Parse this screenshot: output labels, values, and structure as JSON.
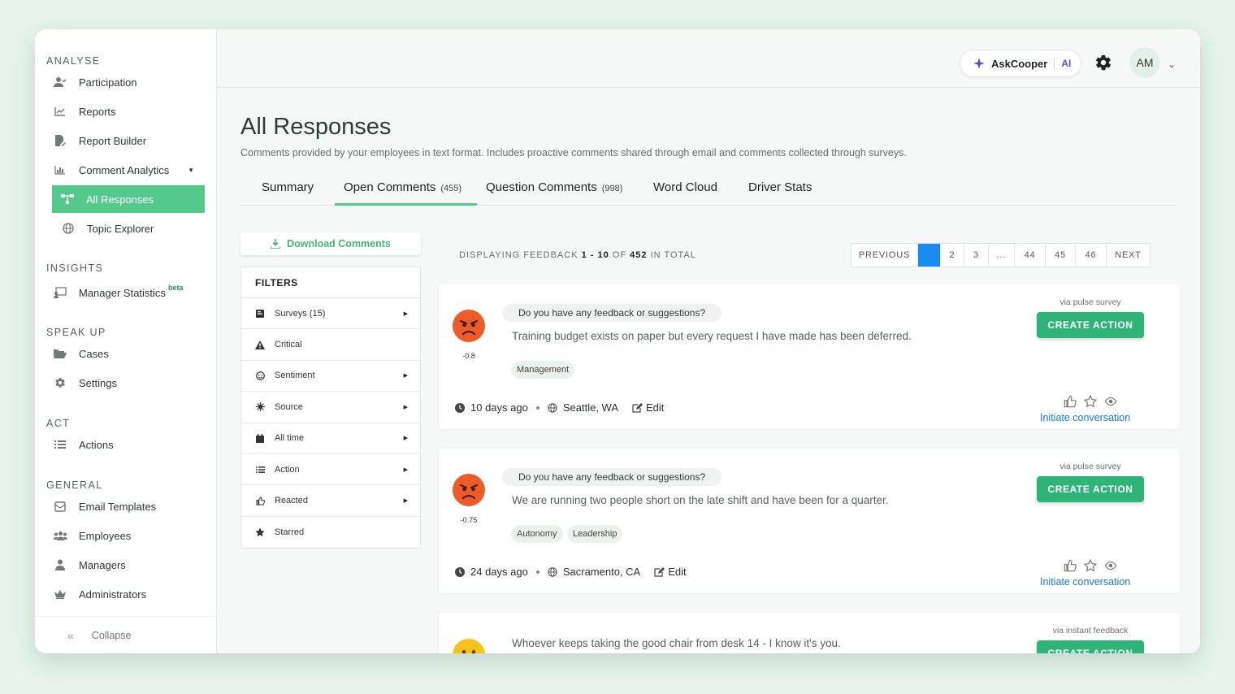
{
  "sidebar": {
    "sections": [
      {
        "title": "ANALYSE",
        "items": [
          {
            "label": "Participation",
            "icon": "user-check-icon"
          },
          {
            "label": "Reports",
            "icon": "line-chart-icon"
          },
          {
            "label": "Report Builder",
            "icon": "file-edit-icon"
          },
          {
            "label": "Comment Analytics",
            "icon": "bar-chart-icon",
            "has_caret": true
          },
          {
            "label": "All Responses",
            "icon": "network-icon",
            "active": true
          },
          {
            "label": "Topic Explorer",
            "icon": "globe-icon"
          }
        ]
      },
      {
        "title": "INSIGHTS",
        "items": [
          {
            "label": "Manager Statistics",
            "badge": "beta",
            "icon": "presentation-icon"
          }
        ]
      },
      {
        "title": "SPEAK UP",
        "items": [
          {
            "label": "Cases",
            "icon": "folder-open-icon"
          },
          {
            "label": "Settings",
            "icon": "gear-icon"
          }
        ]
      },
      {
        "title": "ACT",
        "items": [
          {
            "label": "Actions",
            "icon": "list-icon"
          }
        ]
      },
      {
        "title": "GENERAL",
        "items": [
          {
            "label": "Email Templates",
            "icon": "envelope-icon"
          },
          {
            "label": "Employees",
            "icon": "users-icon"
          },
          {
            "label": "Managers",
            "icon": "user-tie-icon"
          },
          {
            "label": "Administrators",
            "icon": "crown-icon"
          }
        ]
      }
    ],
    "collapse_label": "Collapse"
  },
  "topbar": {
    "ask_label": "AskCooper",
    "ai_label": "AI",
    "avatar_initials": "AM"
  },
  "page": {
    "title": "All Responses",
    "subtitle": "Comments provided by your employees in text format. Includes proactive comments shared through email and comments collected through surveys."
  },
  "tabs": [
    {
      "label": "Summary",
      "count": ""
    },
    {
      "label": "Open Comments",
      "count": "(455)",
      "active": true
    },
    {
      "label": "Question Comments",
      "count": "(998)"
    },
    {
      "label": "Word Cloud",
      "count": ""
    },
    {
      "label": "Driver Stats",
      "count": ""
    }
  ],
  "download_label": "Download Comments",
  "filters": {
    "header": "FILTERS",
    "items": [
      {
        "label": "Surveys (15)",
        "icon": "survey-icon",
        "caret": true
      },
      {
        "label": "Critical",
        "icon": "warning-icon",
        "caret": false
      },
      {
        "label": "Sentiment",
        "icon": "smile-icon",
        "caret": true
      },
      {
        "label": "Source",
        "icon": "source-icon",
        "caret": true
      },
      {
        "label": "All time",
        "icon": "calendar-icon",
        "caret": true
      },
      {
        "label": "Action",
        "icon": "list-icon",
        "caret": true
      },
      {
        "label": "Reacted",
        "icon": "thumbs-up-icon",
        "caret": true
      },
      {
        "label": "Starred",
        "icon": "star-icon",
        "caret": false
      }
    ]
  },
  "display": {
    "prefix": "DISPLAYING FEEDBACK",
    "range": "1 - 10",
    "of": "OF",
    "total": "452",
    "suffix": "IN TOTAL"
  },
  "pagination": [
    "PREVIOUS",
    "1",
    "2",
    "3",
    "...",
    "44",
    "45",
    "46",
    "NEXT"
  ],
  "comments": [
    {
      "question": "Do you have any feedback or suggestions?",
      "text": "Training budget exists on paper but every request I have made has been deferred.",
      "score": "-0.8",
      "sentiment": "angry",
      "tags": [
        "Management"
      ],
      "time": "10 days ago",
      "location": "Seattle, WA",
      "edit": "Edit",
      "via": "via pulse survey",
      "action_label": "CREATE ACTION",
      "initiate": "Initiate conversation"
    },
    {
      "question": "Do you have any feedback or suggestions?",
      "text": "We are running two people short on the late shift and have been for a quarter.",
      "score": "-0.75",
      "sentiment": "angry",
      "tags": [
        "Autonomy",
        "Leadership"
      ],
      "time": "24 days ago",
      "location": "Sacramento, CA",
      "edit": "Edit",
      "via": "via pulse survey",
      "action_label": "CREATE ACTION",
      "initiate": "Initiate conversation"
    },
    {
      "text": "Whoever keeps taking the good chair from desk 14 - I know it's you.",
      "sentiment": "neutral",
      "via": "via instant feedback",
      "action_label": "CREATE ACTION"
    }
  ],
  "colors": {
    "accent": "#54c98c",
    "action_button": "#2fb379",
    "link": "#1a76d2",
    "page_active": "#1a8cf0"
  }
}
